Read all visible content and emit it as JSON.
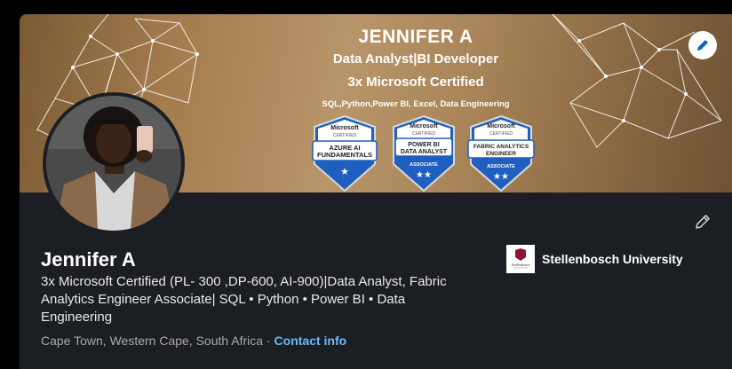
{
  "banner": {
    "name": "JENNIFER A",
    "role": "Data Analyst|BI Developer",
    "certified": "3x Microsoft Certified",
    "skills": "SQL,Python,Power BI, Excel, Data Engineering",
    "badges": [
      {
        "brand": "Microsoft",
        "sub": "CERTIFIED",
        "title1": "AZURE AI",
        "title2": "FUNDAMENTALS",
        "level": "",
        "stars": "★"
      },
      {
        "brand": "Microsoft",
        "sub": "CERTIFIED",
        "title1": "POWER BI",
        "title2": "DATA ANALYST",
        "level": "ASSOCIATE",
        "stars": "★★"
      },
      {
        "brand": "Microsoft",
        "sub": "CERTIFIED",
        "title1": "FABRIC ANALYTICS",
        "title2": "ENGINEER",
        "level": "ASSOCIATE",
        "stars": "★★"
      }
    ]
  },
  "profile": {
    "name": "Jennifer A",
    "headline": "3x Microsoft Certified (PL- 300 ,DP-600, AI-900)|Data Analyst, Fabric Analytics Engineer Associate| SQL • Python • Power BI • Data Engineering",
    "location": "Cape Town, Western Cape, South Africa",
    "separator": " · ",
    "contact_label": "Contact info"
  },
  "education": {
    "school_name": "Stellenbosch University",
    "logo_text": "Stellenbosch"
  },
  "icons": {
    "edit_banner": "pencil-icon",
    "edit_intro": "pencil-icon"
  },
  "colors": {
    "card_bg": "#1b1f23",
    "link": "#71b7fb",
    "badge_blue": "#1f5fbf"
  }
}
